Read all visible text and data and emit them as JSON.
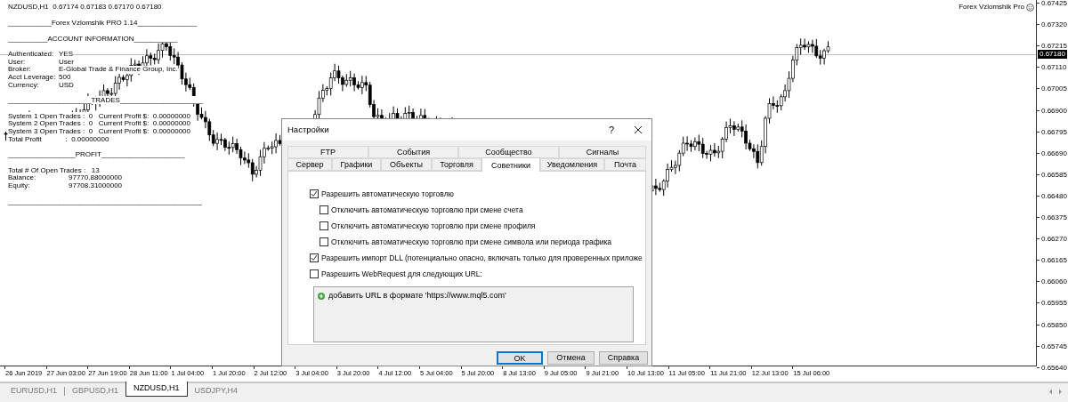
{
  "chart": {
    "symbol_line": "NZDUSD,H1  0.67174 0.67183 0.67170 0.67180",
    "indicator_name": "Forex Vzlomshik Pro",
    "current_price": "0.67180",
    "price_labels": [
      "0.67425",
      "0.67320",
      "0.67215",
      "0.67110",
      "0.67005",
      "0.66900",
      "0.66795",
      "0.66690",
      "0.66585",
      "0.66480",
      "0.66375",
      "0.66270",
      "0.66165",
      "0.66060",
      "0.65955",
      "0.65850",
      "0.65745",
      "0.65640"
    ],
    "time_labels": [
      "26 Jun 2019",
      "27 Jun 03:00",
      "27 Jun 19:00",
      "28 Jun 11:00",
      "1 Jul 04:00",
      "1 Jul 20:00",
      "2 Jul 12:00",
      "3 Jul 04:00",
      "3 Jul 20:00",
      "4 Jul 12:00",
      "5 Jul 04:00",
      "5 Jul 20:00",
      "8 Jul 13:00",
      "9 Jul 05:00",
      "9 Jul 21:00",
      "10 Jul 13:00",
      "11 Jul 05:00",
      "11 Jul 21:00",
      "12 Jul 13:00",
      "15 Jul 06:00"
    ]
  },
  "info_panel": [
    {
      "kind": "title",
      "text": "___________Forex Vzlomshik PRO 1.14_______________"
    },
    {
      "kind": "heading",
      "text": "__________ACCOUNT INFORMATION___________"
    },
    {
      "kind": "pair",
      "label": "Authenticated:",
      "value": "YES"
    },
    {
      "kind": "pair",
      "label": "User:",
      "value": "User"
    },
    {
      "kind": "pair",
      "label": "Broker:",
      "value": "E-Global Trade & Finance Group, Inc."
    },
    {
      "kind": "pair",
      "label": "Acct Leverage:",
      "value": "500"
    },
    {
      "kind": "pair",
      "label": "Currency:",
      "value": "USD"
    },
    {
      "kind": "heading",
      "text": "_____________________TRADES_____________________"
    },
    {
      "kind": "text",
      "text": "System 1 Open Trades :  0   Current Profit $:  0.00000000"
    },
    {
      "kind": "text",
      "text": "System 2 Open Trades :  0   Current Profit $:  0.00000000"
    },
    {
      "kind": "text",
      "text": "System 3 Open Trades :  0   Current Profit $:  0.00000000"
    },
    {
      "kind": "text",
      "text": "Total Profit            :  0.00000000"
    },
    {
      "kind": "heading",
      "text": "_________________PROFIT_____________________"
    },
    {
      "kind": "text",
      "text": "Total # Of Open Trades :   13"
    },
    {
      "kind": "wide_pair",
      "label": "Balance:",
      "value": "97770.88000000"
    },
    {
      "kind": "wide_pair",
      "label": "Equity:",
      "value": "97708.31000000"
    },
    {
      "kind": "heading",
      "text": "_________________________________________________"
    }
  ],
  "symbol_tabs": [
    {
      "label": "EURUSD,H1",
      "selected": false
    },
    {
      "label": "GBPUSD,H1",
      "selected": false
    },
    {
      "label": "NZDUSD,H1",
      "selected": true
    },
    {
      "label": "USDJPY,H4",
      "selected": false
    }
  ],
  "dialog": {
    "title": "Настройки",
    "help": "?",
    "tab_rows": [
      [
        {
          "label": "FTP",
          "selected": false
        },
        {
          "label": "События",
          "selected": false
        },
        {
          "label": "Сообщество",
          "selected": false
        },
        {
          "label": "Сигналы",
          "selected": false
        }
      ],
      [
        {
          "label": "Сервер",
          "selected": false
        },
        {
          "label": "Графики",
          "selected": false
        },
        {
          "label": "Объекты",
          "selected": false
        },
        {
          "label": "Торговля",
          "selected": false
        },
        {
          "label": "Советники",
          "selected": true
        },
        {
          "label": "Уведомления",
          "selected": false
        },
        {
          "label": "Почта",
          "selected": false
        }
      ]
    ],
    "options": [
      {
        "label": "Разрешить автоматическую торговлю",
        "checked": true,
        "children": [
          {
            "label": "Отключить автоматическую торговлю при смене счета",
            "checked": false
          },
          {
            "label": "Отключить автоматическую торговлю при смене профиля",
            "checked": false
          },
          {
            "label": "Отключить автоматическую торговлю при смене символа или периода графика",
            "checked": false
          }
        ]
      },
      {
        "label": "Разрешить импорт DLL (потенциально опасно, включать только для проверенных приложе",
        "checked": true
      },
      {
        "label": "Разрешить WebRequest для следующих URL:",
        "checked": false
      }
    ],
    "url_list": [
      "добавить URL в формате 'https://www.mql5.com'"
    ],
    "buttons": [
      {
        "label": "OK",
        "default": true
      },
      {
        "label": "Отмена",
        "default": false
      },
      {
        "label": "Справка",
        "default": false
      }
    ]
  }
}
